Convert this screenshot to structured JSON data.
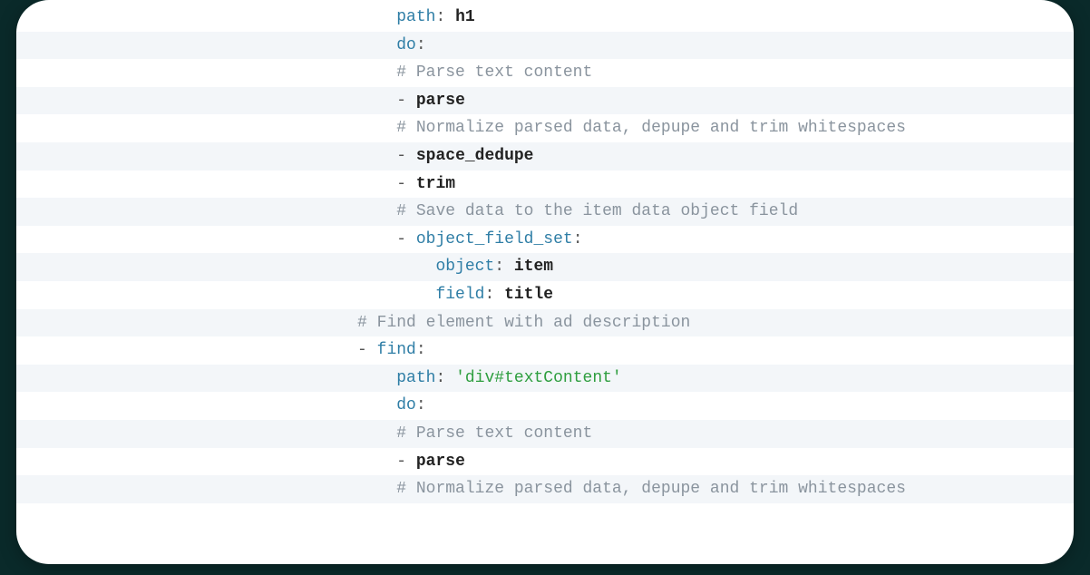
{
  "code": {
    "lines": [
      {
        "indent": 24,
        "tokens": [
          {
            "t": "path",
            "c": "key"
          },
          {
            "t": ":",
            "c": "punct"
          },
          {
            "t": " ",
            "c": "plain"
          },
          {
            "t": "h1",
            "c": "val"
          }
        ]
      },
      {
        "indent": 24,
        "tokens": [
          {
            "t": "do",
            "c": "key"
          },
          {
            "t": ":",
            "c": "punct"
          }
        ]
      },
      {
        "indent": 24,
        "tokens": [
          {
            "t": "# Parse text content",
            "c": "comment"
          }
        ]
      },
      {
        "indent": 24,
        "tokens": [
          {
            "t": "- ",
            "c": "punct"
          },
          {
            "t": "parse",
            "c": "val"
          }
        ]
      },
      {
        "indent": 24,
        "tokens": [
          {
            "t": "# Normalize parsed data, depupe and trim whitespaces",
            "c": "comment"
          }
        ]
      },
      {
        "indent": 24,
        "tokens": [
          {
            "t": "- ",
            "c": "punct"
          },
          {
            "t": "space_dedupe",
            "c": "val"
          }
        ]
      },
      {
        "indent": 24,
        "tokens": [
          {
            "t": "- ",
            "c": "punct"
          },
          {
            "t": "trim",
            "c": "val"
          }
        ]
      },
      {
        "indent": 24,
        "tokens": [
          {
            "t": "# Save data to the item data object field",
            "c": "comment"
          }
        ]
      },
      {
        "indent": 24,
        "tokens": [
          {
            "t": "- ",
            "c": "punct"
          },
          {
            "t": "object_field_set",
            "c": "key"
          },
          {
            "t": ":",
            "c": "punct"
          }
        ]
      },
      {
        "indent": 28,
        "tokens": [
          {
            "t": "object",
            "c": "key"
          },
          {
            "t": ":",
            "c": "punct"
          },
          {
            "t": " ",
            "c": "plain"
          },
          {
            "t": "item",
            "c": "val"
          }
        ]
      },
      {
        "indent": 28,
        "tokens": [
          {
            "t": "field",
            "c": "key"
          },
          {
            "t": ":",
            "c": "punct"
          },
          {
            "t": " ",
            "c": "plain"
          },
          {
            "t": "title",
            "c": "val"
          }
        ]
      },
      {
        "indent": 20,
        "tokens": [
          {
            "t": "# Find element with ad description",
            "c": "comment"
          }
        ]
      },
      {
        "indent": 20,
        "tokens": [
          {
            "t": "- ",
            "c": "punct"
          },
          {
            "t": "find",
            "c": "key"
          },
          {
            "t": ":",
            "c": "punct"
          }
        ]
      },
      {
        "indent": 24,
        "tokens": [
          {
            "t": "path",
            "c": "key"
          },
          {
            "t": ":",
            "c": "punct"
          },
          {
            "t": " ",
            "c": "plain"
          },
          {
            "t": "'div#textContent'",
            "c": "string"
          }
        ]
      },
      {
        "indent": 24,
        "tokens": [
          {
            "t": "do",
            "c": "key"
          },
          {
            "t": ":",
            "c": "punct"
          }
        ]
      },
      {
        "indent": 24,
        "tokens": [
          {
            "t": "# Parse text content",
            "c": "comment"
          }
        ]
      },
      {
        "indent": 24,
        "tokens": [
          {
            "t": "- ",
            "c": "punct"
          },
          {
            "t": "parse",
            "c": "val"
          }
        ]
      },
      {
        "indent": 24,
        "tokens": [
          {
            "t": "# Normalize parsed data, depupe and trim whitespaces",
            "c": "comment"
          }
        ]
      }
    ]
  }
}
